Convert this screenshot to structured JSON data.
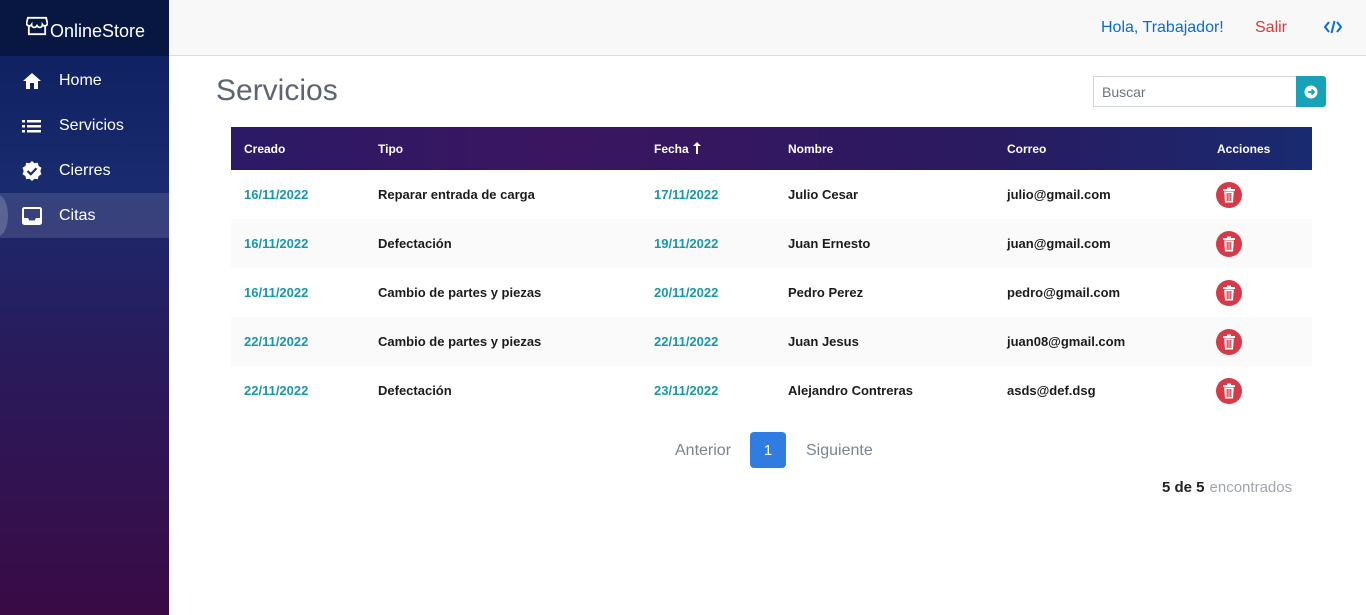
{
  "app": {
    "brand": "OnlineStore"
  },
  "sidebar": {
    "items": [
      {
        "label": "Home",
        "icon": "home-icon"
      },
      {
        "label": "Servicios",
        "icon": "list-icon"
      },
      {
        "label": "Cierres",
        "icon": "badge-check-icon"
      },
      {
        "label": "Citas",
        "icon": "inbox-icon"
      }
    ],
    "active": "Citas"
  },
  "topbar": {
    "greeting": "Hola, Trabajador!",
    "logout": "Salir"
  },
  "page": {
    "title": "Servicios"
  },
  "search": {
    "placeholder": "Buscar",
    "value": ""
  },
  "table": {
    "headers": {
      "creado": "Creado",
      "tipo": "Tipo",
      "fecha": "Fecha",
      "nombre": "Nombre",
      "correo": "Correo",
      "acciones": "Acciones"
    },
    "rows": [
      {
        "creado": "16/11/2022",
        "tipo": "Reparar entrada de carga",
        "fecha": "17/11/2022",
        "nombre": "Julio Cesar",
        "correo": "julio@gmail.com"
      },
      {
        "creado": "16/11/2022",
        "tipo": "Defectación",
        "fecha": "19/11/2022",
        "nombre": "Juan Ernesto",
        "correo": "juan@gmail.com"
      },
      {
        "creado": "16/11/2022",
        "tipo": "Cambio de partes y piezas",
        "fecha": "20/11/2022",
        "nombre": "Pedro Perez",
        "correo": "pedro@gmail.com"
      },
      {
        "creado": "22/11/2022",
        "tipo": "Cambio de partes y piezas",
        "fecha": "22/11/2022",
        "nombre": "Juan Jesus",
        "correo": "juan08@gmail.com"
      },
      {
        "creado": "22/11/2022",
        "tipo": "Defectación",
        "fecha": "23/11/2022",
        "nombre": "Alejandro Contreras",
        "correo": "asds@def.dsg"
      }
    ]
  },
  "pagination": {
    "prev": "Anterior",
    "current": "1",
    "next": "Siguiente"
  },
  "results": {
    "count": "5 de 5",
    "suffix": "encontrados"
  },
  "colors": {
    "accent": "#17a2b8",
    "page_active": "#2f7de1",
    "danger": "#d43a48",
    "link": "#0b6cd0"
  }
}
